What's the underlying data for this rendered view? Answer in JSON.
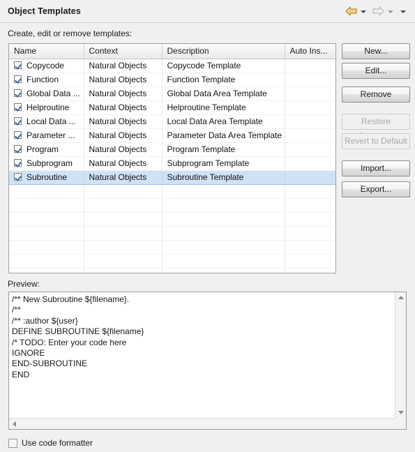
{
  "window": {
    "title": "Object Templates",
    "section_label": "Create, edit or remove templates:",
    "preview_label": "Preview:"
  },
  "nav": {
    "back_icon": "back-arrow-icon",
    "back_menu_icon": "chevron-down-icon",
    "forward_icon": "forward-arrow-icon",
    "forward_menu_icon": "chevron-down-icon",
    "view_menu_icon": "chevron-down-icon",
    "back_enabled": true,
    "forward_enabled": false,
    "back_color": "#e8b84b",
    "forward_color": "#d4d4d4"
  },
  "table": {
    "columns": [
      "Name",
      "Context",
      "Description",
      "Auto Ins..."
    ],
    "rows": [
      {
        "checked": true,
        "name": "Copycode",
        "context": "Natural Objects",
        "description": "Copycode Template",
        "auto": "",
        "selected": false
      },
      {
        "checked": true,
        "name": "Function",
        "context": "Natural Objects",
        "description": "Function Template",
        "auto": "",
        "selected": false
      },
      {
        "checked": true,
        "name": "Global Data ...",
        "context": "Natural Objects",
        "description": "Global Data Area Template",
        "auto": "",
        "selected": false
      },
      {
        "checked": true,
        "name": "Helproutine",
        "context": "Natural Objects",
        "description": "Helproutine Template",
        "auto": "",
        "selected": false
      },
      {
        "checked": true,
        "name": "Local Data ...",
        "context": "Natural Objects",
        "description": "Local Data Area Template",
        "auto": "",
        "selected": false
      },
      {
        "checked": true,
        "name": "Parameter ...",
        "context": "Natural Objects",
        "description": "Parameter Data Area Template",
        "auto": "",
        "selected": false
      },
      {
        "checked": true,
        "name": "Program",
        "context": "Natural Objects",
        "description": "Program Template",
        "auto": "",
        "selected": false
      },
      {
        "checked": true,
        "name": "Subprogram",
        "context": "Natural Objects",
        "description": "Subprogram Template",
        "auto": "",
        "selected": false
      },
      {
        "checked": true,
        "name": "Subroutine",
        "context": "Natural Objects",
        "description": "Subroutine Template",
        "auto": "",
        "selected": true
      }
    ],
    "empty_row_count": 7,
    "selection_color": "#cfe2f6"
  },
  "buttons": [
    {
      "label": "New...",
      "enabled": true,
      "name": "new-button"
    },
    {
      "label": "Edit...",
      "enabled": true,
      "name": "edit-button"
    },
    {
      "label": "Remove",
      "enabled": true,
      "name": "remove-button"
    },
    {
      "label": "Restore Removed",
      "enabled": false,
      "name": "restore-removed-button"
    },
    {
      "label": "Revert to Default",
      "enabled": false,
      "name": "revert-to-default-button"
    },
    {
      "label": "Import...",
      "enabled": true,
      "name": "import-button"
    },
    {
      "label": "Export...",
      "enabled": true,
      "name": "export-button"
    }
  ],
  "preview": {
    "content": "/** New Subroutine ${filename}.\n/**\n/** :author ${user}\nDEFINE SUBROUTINE ${filename}\n/* TODO: Enter your code here\nIGNORE\nEND-SUBROUTINE\nEND"
  },
  "footer": {
    "checkbox_label": "Use code formatter",
    "checked": false
  }
}
